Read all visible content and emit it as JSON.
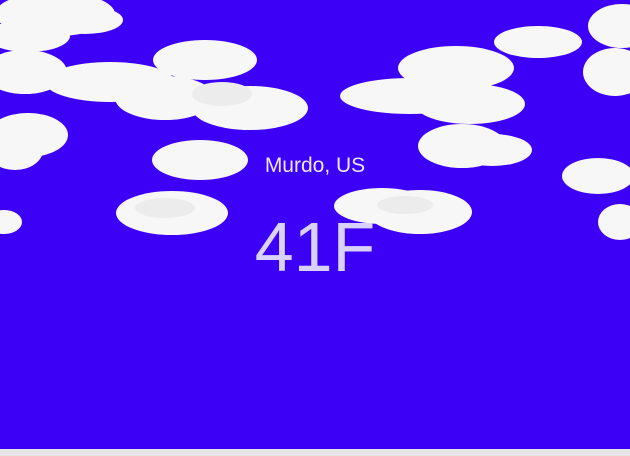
{
  "weather": {
    "location": "Murdo, US",
    "temperature": "41F"
  },
  "colors": {
    "sky": "#3d00f7",
    "cloud": "#f7f7f7",
    "location_text": "#ece6ff",
    "temperature_text": "#d9d2ff"
  }
}
